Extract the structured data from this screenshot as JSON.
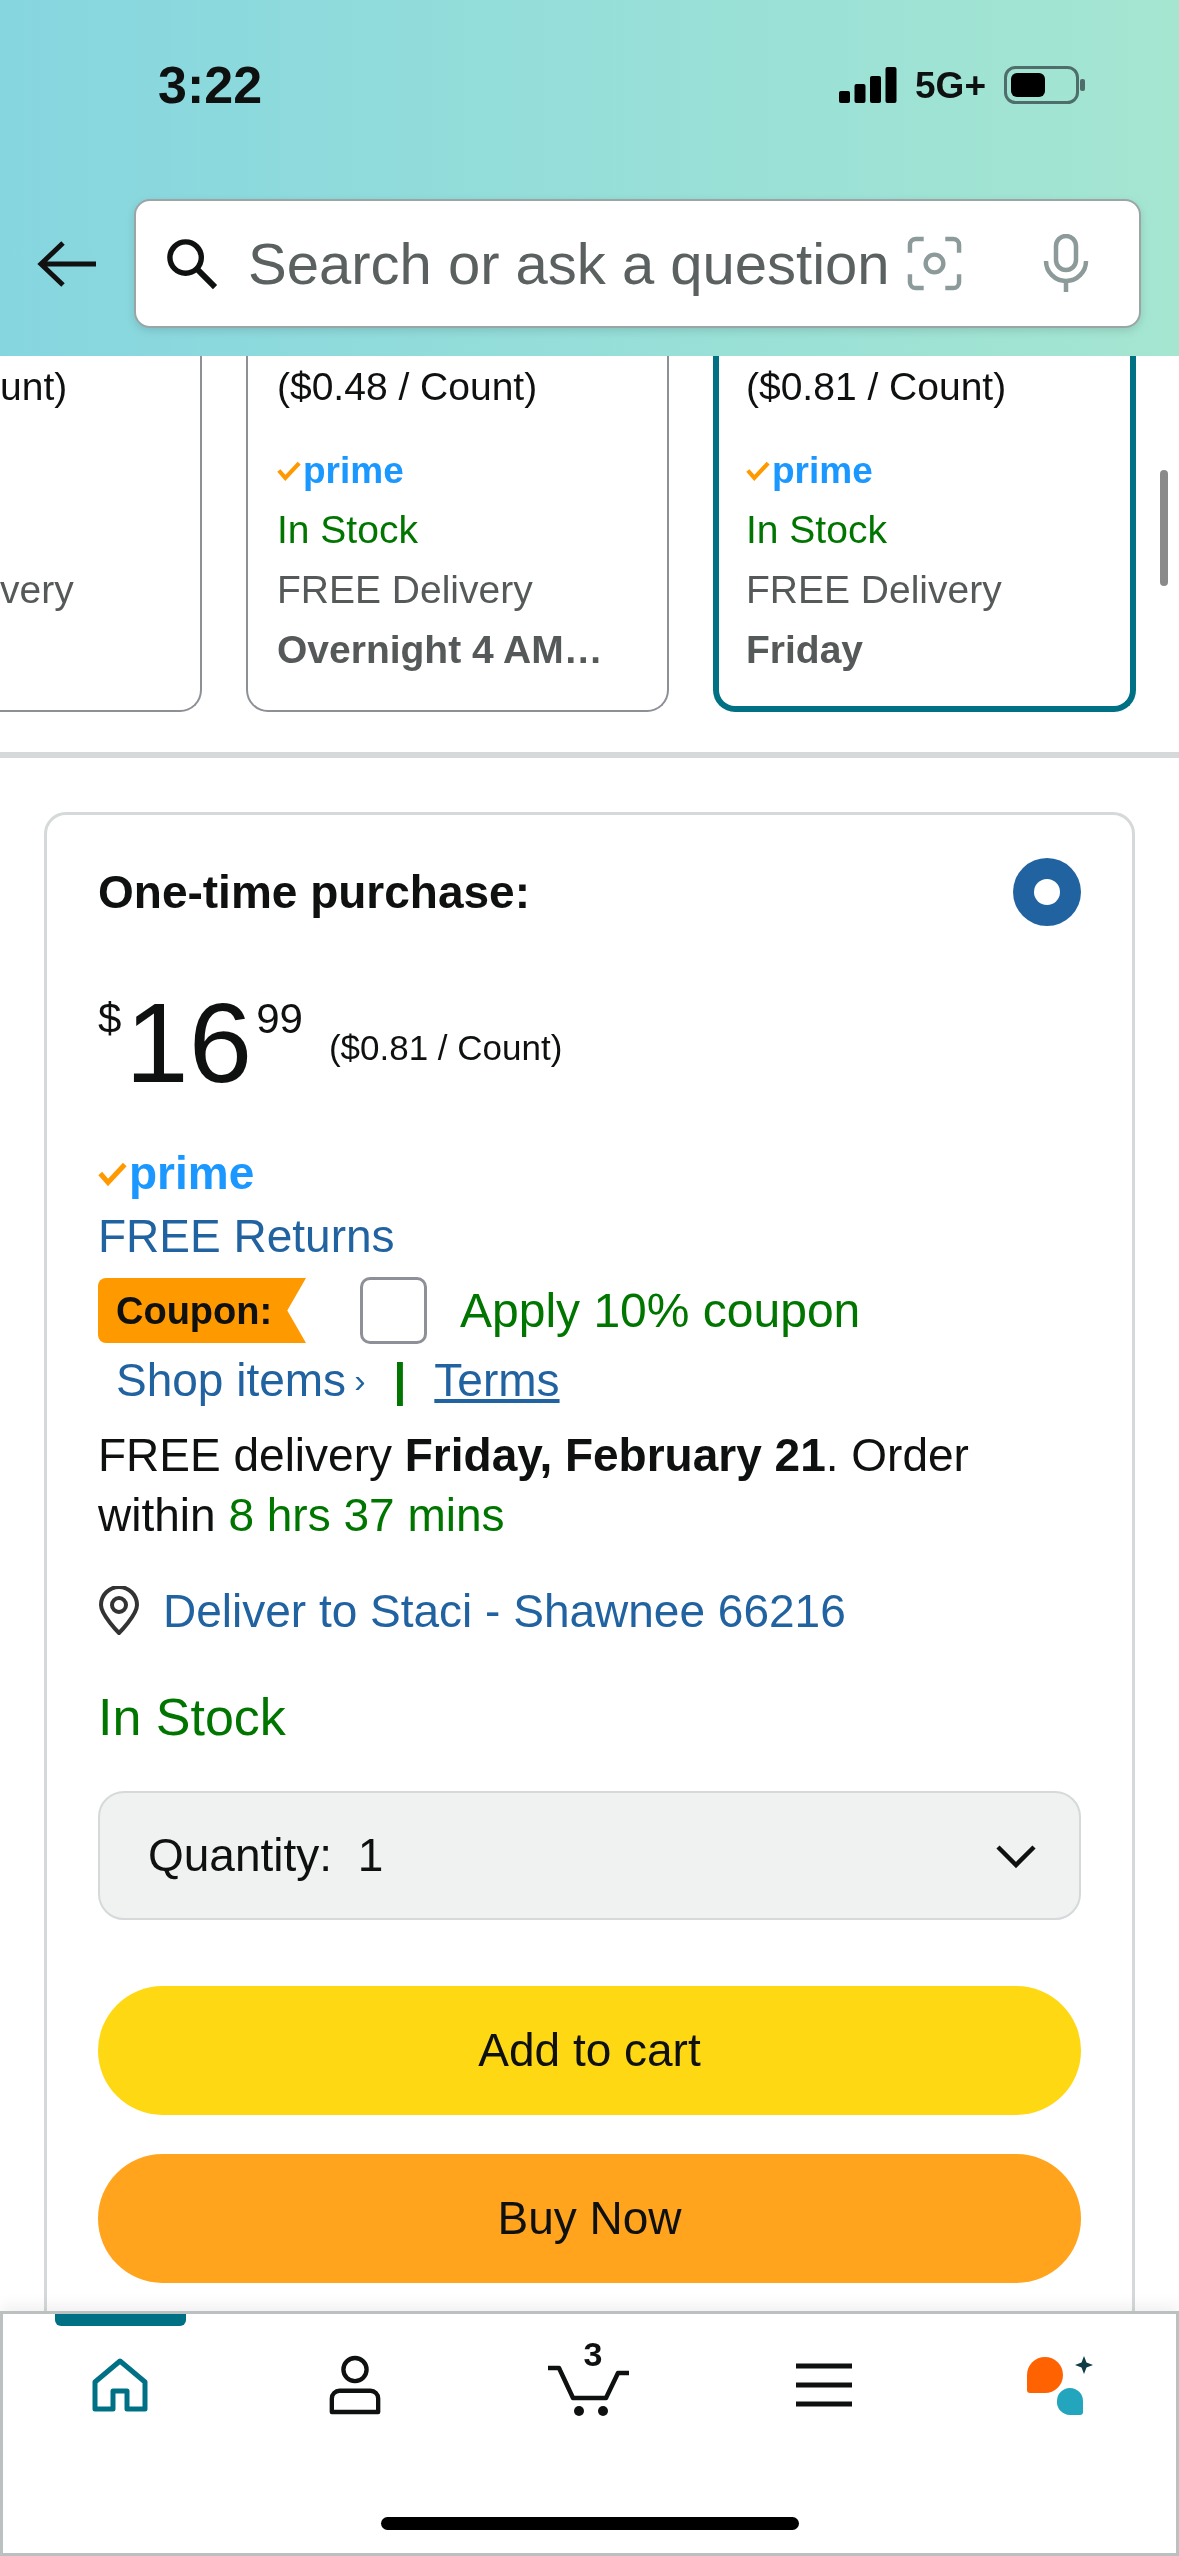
{
  "status_bar": {
    "time": "3:22",
    "network": "5G+"
  },
  "search": {
    "placeholder": "Search or ask a question"
  },
  "offer_cards": [
    {
      "kind": "clipped",
      "selected": false,
      "unit_price": "unt)",
      "delivery_label": "very"
    },
    {
      "kind": "full",
      "selected": false,
      "unit_price": "($0.48 / Count)",
      "badge": "prime",
      "stock": "In Stock",
      "delivery_label": "FREE Delivery",
      "delivery_time": "Overnight 4 AM…"
    },
    {
      "kind": "full",
      "selected": true,
      "unit_price": "($0.81 / Count)",
      "badge": "prime",
      "stock": "In Stock",
      "delivery_label": "FREE Delivery",
      "delivery_time": "Friday"
    }
  ],
  "purchase_option": {
    "title": "One-time purchase:",
    "selected": true,
    "price": {
      "currency": "$",
      "whole": "16",
      "fraction": "99",
      "unit_price": "($0.81 / Count)"
    },
    "badge": "prime",
    "returns_link": "FREE Returns",
    "coupon": {
      "label": "Coupon:",
      "checked": false,
      "text": "Apply 10% coupon",
      "shop_link": "Shop items",
      "shop_caret": "›",
      "separator": "|",
      "terms_link": "Terms"
    },
    "delivery": {
      "text": "FREE delivery **Friday, February 21**. Order within",
      "countdown": "8 hrs 37 mins"
    },
    "location_link": "Deliver to Staci - Shawnee 66216",
    "stock": "In Stock",
    "quantity": {
      "label": "Quantity:",
      "value": "1"
    },
    "buttons": [
      {
        "kind": "add_to_cart",
        "label": "Add to cart"
      },
      {
        "kind": "buy_now",
        "label": "Buy Now"
      }
    ]
  },
  "bottom_nav": [
    {
      "kind": "home",
      "selected": true
    },
    {
      "kind": "account",
      "selected": false
    },
    {
      "kind": "cart",
      "selected": false,
      "count": "3"
    },
    {
      "kind": "menu",
      "selected": false
    },
    {
      "kind": "assistant",
      "selected": false
    }
  ]
}
